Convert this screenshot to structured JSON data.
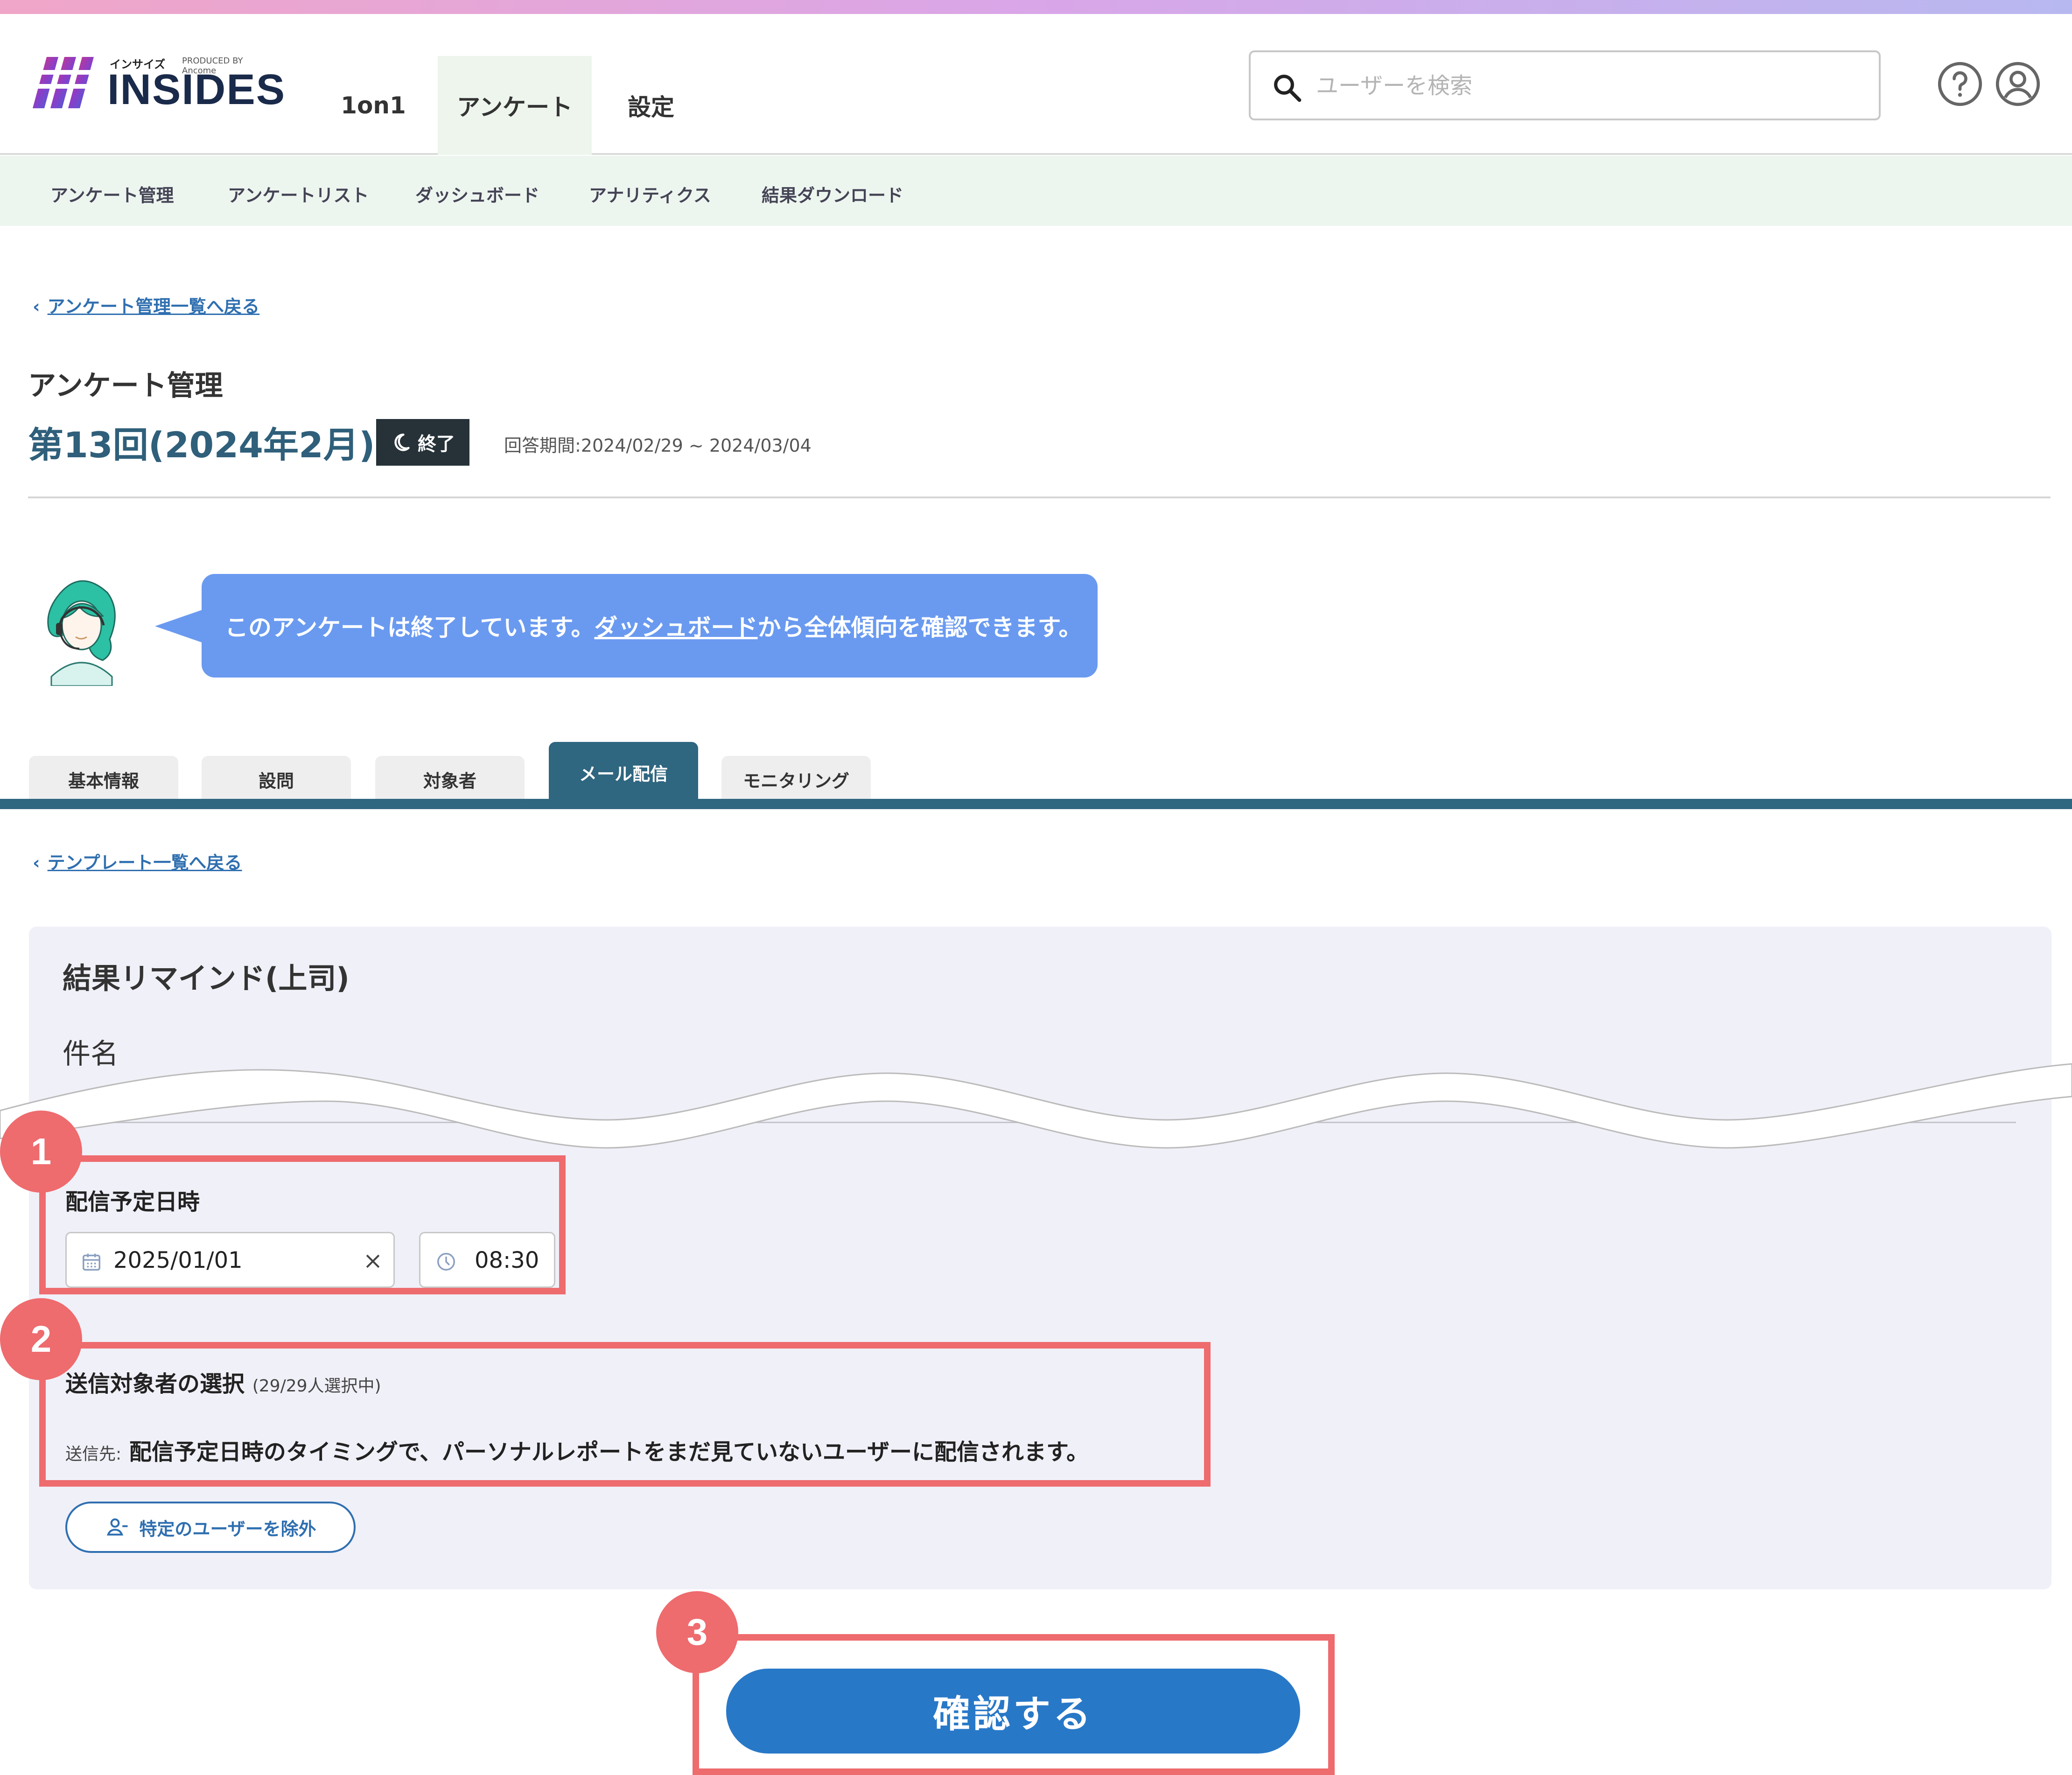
{
  "brand": {
    "small_text": "インサイズ",
    "produced_by": "PRODUCED BY Ancome",
    "logo_text": "INSIDES",
    "colors": {
      "accent": "#2878c8",
      "annotation": "#ee6b6e",
      "tab_active": "#2f6680"
    }
  },
  "header": {
    "tabs": [
      {
        "label": "1on1"
      },
      {
        "label": "アンケート",
        "active": true
      },
      {
        "label": "設定"
      }
    ],
    "search": {
      "placeholder": "ユーザーを検索",
      "icon": "search-icon"
    },
    "icons": [
      "help-icon",
      "user-account-icon"
    ]
  },
  "subnav": {
    "items": [
      {
        "label": "アンケート管理"
      },
      {
        "label": "アンケートリスト"
      },
      {
        "label": "ダッシュボード"
      },
      {
        "label": "アナリティクス"
      },
      {
        "label": "結果ダウンロード"
      }
    ]
  },
  "page": {
    "back_link": "アンケート管理一覧へ戻る",
    "section_label": "アンケート管理",
    "survey_title": "第13回(2024年2月)",
    "status_badge": "終了",
    "period": "回答期間:2024/02/29 ~ 2024/03/04"
  },
  "notice_bubble": {
    "before": "このアンケートは終了しています。",
    "link": "ダッシュボード",
    "after": "から全体傾向を確認できます。"
  },
  "tabs": [
    {
      "label": "基本情報"
    },
    {
      "label": "設問"
    },
    {
      "label": "対象者"
    },
    {
      "label": "メール配信",
      "active": true
    },
    {
      "label": "モニタリング"
    }
  ],
  "template": {
    "back_link": "テンプレート一覧へ戻る",
    "title": "結果リマインド(上司)",
    "subject_label": "件名"
  },
  "schedule": {
    "label": "配信予定日時",
    "date_value": "2025/01/01",
    "time_value": "08:30"
  },
  "targets": {
    "label": "送信対象者の選択",
    "count": "(29/29人選択中)",
    "notice_prefix": "送信先:",
    "notice_text": "配信予定日時のタイミングで、パーソナルレポートをまだ見ていないユーザーに配信されます。",
    "exclude_button": "特定のユーザーを除外"
  },
  "confirm_button": "確認する",
  "annotations": [
    "1",
    "2",
    "3"
  ]
}
